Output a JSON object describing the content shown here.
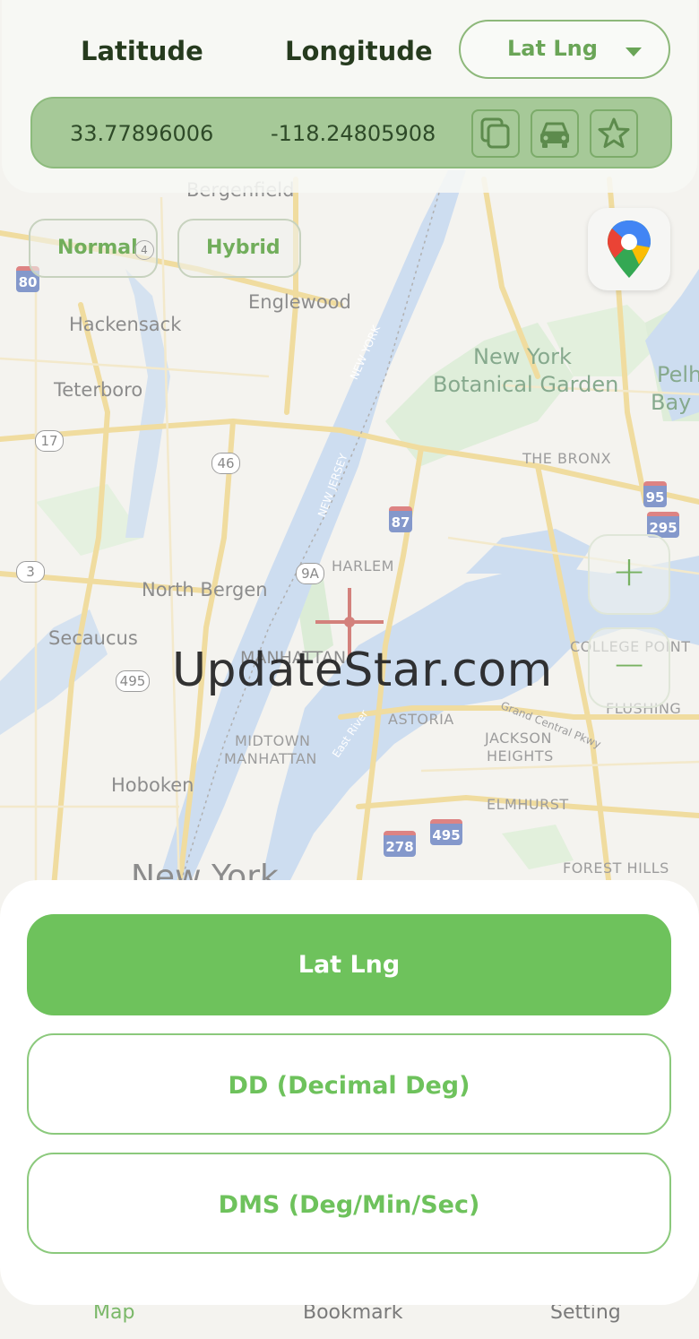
{
  "header": {
    "latitude_label": "Latitude",
    "longitude_label": "Longitude",
    "format_selected": "Lat Lng",
    "latitude_value": "33.77896006",
    "longitude_value": "-118.24805908",
    "icons": [
      "copy-icon",
      "car-icon",
      "star-icon"
    ]
  },
  "map": {
    "type_buttons": {
      "normal": "Normal",
      "hybrid": "Hybrid",
      "normal_badge": "4"
    },
    "zoom_in": "+",
    "zoom_out": "−",
    "labels": {
      "bergenfield": "Bergenfield",
      "englewood": "Englewood",
      "hackensack": "Hackensack",
      "teterboro": "Teterboro",
      "new_york_bg": "New York",
      "botanical_garden": "Botanical Garden",
      "pelham_bay_1": "Pelh",
      "pelham_bay_2": "Bay P",
      "the_bronx": "THE BRONX",
      "harlem": "HARLEM",
      "north_bergen": "North Bergen",
      "secaucus": "Secaucus",
      "manhattan": "MANHATTAN",
      "college_point": "COLLEGE POINT",
      "flushing": "FLUSHING",
      "astoria": "ASTORIA",
      "midtown": "MIDTOWN",
      "midtown2": "MANHATTAN",
      "jackson": "JACKSON",
      "heights": "HEIGHTS",
      "hoboken": "Hoboken",
      "elmhurst": "ELMHURST",
      "forest_hills": "FOREST HILLS",
      "new_york_city": "New York",
      "river_ny": "NEW YORK",
      "river_nj": "NEW JERSEY",
      "east_river": "East River",
      "grand_central": "Grand Central Pkwy"
    },
    "shields": {
      "i80": "80",
      "r17": "17",
      "r46": "46",
      "i87": "87",
      "r9a": "9A",
      "r3": "3",
      "r495a": "495",
      "i95": "95",
      "i295": "295",
      "i278": "278",
      "i495": "495"
    },
    "watermark": "UpdateStar.com",
    "accent_color": "#6ec25c"
  },
  "format_sheet": {
    "options": [
      "Lat Lng",
      "DD (Decimal Deg)",
      "DMS (Deg/Min/Sec)"
    ],
    "selected_index": 0
  },
  "bottom_nav": {
    "items": [
      "Map",
      "Bookmark",
      "Setting"
    ]
  }
}
